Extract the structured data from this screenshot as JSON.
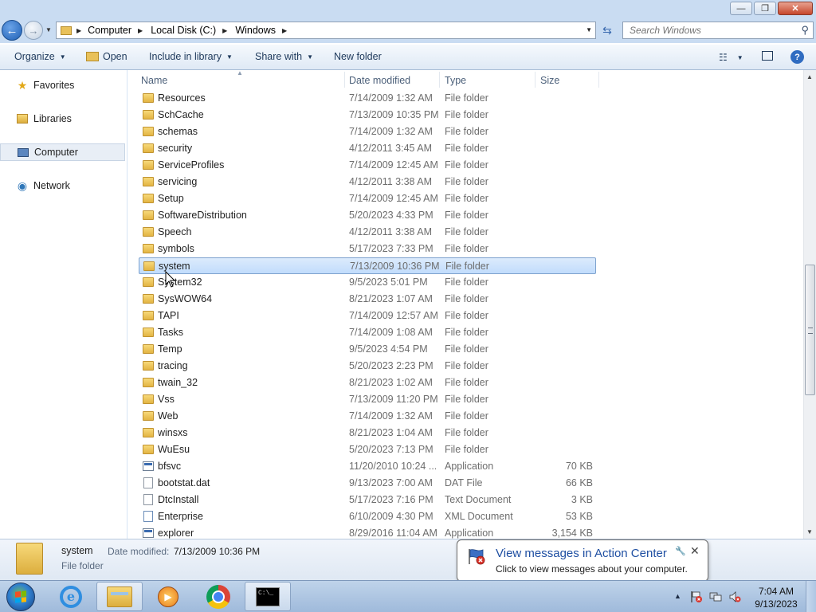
{
  "window": {
    "controls": {
      "minimize": "—",
      "maximize": "❐",
      "close": "✕"
    }
  },
  "nav": {
    "back_glyph": "←",
    "forward_glyph": "→",
    "breadcrumb": [
      "Computer",
      "Local Disk (C:)",
      "Windows"
    ],
    "search_placeholder": "Search Windows"
  },
  "toolbar": {
    "organize": "Organize",
    "open": "Open",
    "include_in_library": "Include in library",
    "share_with": "Share with",
    "new_folder": "New folder",
    "help": "?"
  },
  "sidebar": {
    "items": [
      {
        "label": "Favorites",
        "icon": "star-icon"
      },
      {
        "label": "Libraries",
        "icon": "libraries-icon"
      },
      {
        "label": "Computer",
        "icon": "computer-icon"
      },
      {
        "label": "Network",
        "icon": "network-icon"
      }
    ]
  },
  "columns": {
    "name": "Name",
    "date": "Date modified",
    "type": "Type",
    "size": "Size"
  },
  "files": [
    {
      "name": "Resources",
      "date": "7/14/2009 1:32 AM",
      "type": "File folder",
      "size": "",
      "icon": "folder"
    },
    {
      "name": "SchCache",
      "date": "7/13/2009 10:35 PM",
      "type": "File folder",
      "size": "",
      "icon": "folder"
    },
    {
      "name": "schemas",
      "date": "7/14/2009 1:32 AM",
      "type": "File folder",
      "size": "",
      "icon": "folder"
    },
    {
      "name": "security",
      "date": "4/12/2011 3:45 AM",
      "type": "File folder",
      "size": "",
      "icon": "folder"
    },
    {
      "name": "ServiceProfiles",
      "date": "7/14/2009 12:45 AM",
      "type": "File folder",
      "size": "",
      "icon": "folder"
    },
    {
      "name": "servicing",
      "date": "4/12/2011 3:38 AM",
      "type": "File folder",
      "size": "",
      "icon": "folder"
    },
    {
      "name": "Setup",
      "date": "7/14/2009 12:45 AM",
      "type": "File folder",
      "size": "",
      "icon": "folder"
    },
    {
      "name": "SoftwareDistribution",
      "date": "5/20/2023 4:33 PM",
      "type": "File folder",
      "size": "",
      "icon": "folder"
    },
    {
      "name": "Speech",
      "date": "4/12/2011 3:38 AM",
      "type": "File folder",
      "size": "",
      "icon": "folder"
    },
    {
      "name": "symbols",
      "date": "5/17/2023 7:33 PM",
      "type": "File folder",
      "size": "",
      "icon": "folder"
    },
    {
      "name": "system",
      "date": "7/13/2009 10:36 PM",
      "type": "File folder",
      "size": "",
      "icon": "folder",
      "selected": true
    },
    {
      "name": "System32",
      "date": "9/5/2023 5:01 PM",
      "type": "File folder",
      "size": "",
      "icon": "folder"
    },
    {
      "name": "SysWOW64",
      "date": "8/21/2023 1:07 AM",
      "type": "File folder",
      "size": "",
      "icon": "folder"
    },
    {
      "name": "TAPI",
      "date": "7/14/2009 12:57 AM",
      "type": "File folder",
      "size": "",
      "icon": "folder"
    },
    {
      "name": "Tasks",
      "date": "7/14/2009 1:08 AM",
      "type": "File folder",
      "size": "",
      "icon": "folder"
    },
    {
      "name": "Temp",
      "date": "9/5/2023 4:54 PM",
      "type": "File folder",
      "size": "",
      "icon": "folder"
    },
    {
      "name": "tracing",
      "date": "5/20/2023 2:23 PM",
      "type": "File folder",
      "size": "",
      "icon": "folder"
    },
    {
      "name": "twain_32",
      "date": "8/21/2023 1:02 AM",
      "type": "File folder",
      "size": "",
      "icon": "folder"
    },
    {
      "name": "Vss",
      "date": "7/13/2009 11:20 PM",
      "type": "File folder",
      "size": "",
      "icon": "folder"
    },
    {
      "name": "Web",
      "date": "7/14/2009 1:32 AM",
      "type": "File folder",
      "size": "",
      "icon": "folder"
    },
    {
      "name": "winsxs",
      "date": "8/21/2023 1:04 AM",
      "type": "File folder",
      "size": "",
      "icon": "folder"
    },
    {
      "name": "WuEsu",
      "date": "5/20/2023 7:13 PM",
      "type": "File folder",
      "size": "",
      "icon": "folder"
    },
    {
      "name": "bfsvc",
      "date": "11/20/2010 10:24 ...",
      "type": "Application",
      "size": "70 KB",
      "icon": "app"
    },
    {
      "name": "bootstat.dat",
      "date": "9/13/2023 7:00 AM",
      "type": "DAT File",
      "size": "66 KB",
      "icon": "doc"
    },
    {
      "name": "DtcInstall",
      "date": "5/17/2023 7:16 PM",
      "type": "Text Document",
      "size": "3 KB",
      "icon": "doc"
    },
    {
      "name": "Enterprise",
      "date": "6/10/2009 4:30 PM",
      "type": "XML Document",
      "size": "53 KB",
      "icon": "xml"
    },
    {
      "name": "explorer",
      "date": "8/29/2016 11:04 AM",
      "type": "Application",
      "size": "3,154 KB",
      "icon": "app"
    }
  ],
  "scroll": {
    "position_fraction": 0.62
  },
  "details": {
    "name": "system",
    "date_label": "Date modified:",
    "date_value": "7/13/2009 10:36 PM",
    "type": "File folder"
  },
  "balloon": {
    "title": "View messages in Action Center",
    "text": "Click to view messages about your computer.",
    "close": "✕"
  },
  "taskbar": {
    "apps": [
      {
        "name": "internet-explorer",
        "icon": "ie-icon"
      },
      {
        "name": "windows-explorer",
        "icon": "explorer-icon",
        "active": true
      },
      {
        "name": "media-player",
        "icon": "media-player-icon"
      },
      {
        "name": "chrome",
        "icon": "chrome-icon"
      },
      {
        "name": "command-prompt",
        "icon": "cmd-icon"
      }
    ],
    "ie_glyph": "e",
    "cmd_text": "C:\\_",
    "time": "7:04 AM",
    "date": "9/13/2023"
  },
  "colors": {
    "accent": "#3b6bb0",
    "selection": "#c1dcfc",
    "balloon_title": "#1f4fa2"
  }
}
